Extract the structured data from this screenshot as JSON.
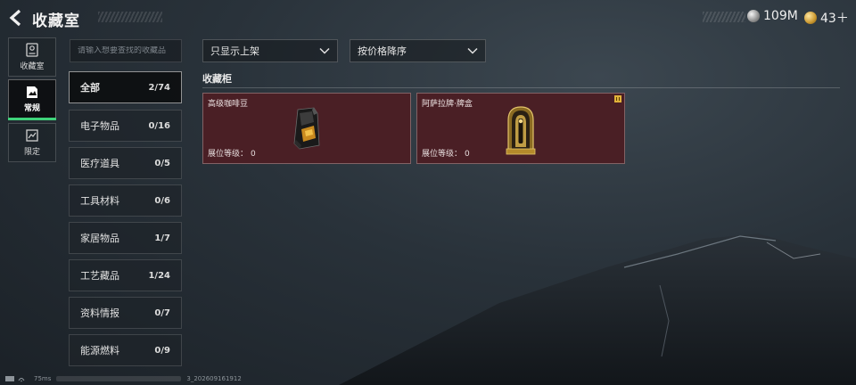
{
  "header": {
    "title": "收藏室",
    "currency": [
      {
        "icon": "silver-coin-icon",
        "value": "109M"
      },
      {
        "icon": "gold-coin-icon",
        "value": "43＋"
      }
    ]
  },
  "nav": [
    {
      "label": "收藏室",
      "icon": "collection-room-icon",
      "active": false
    },
    {
      "label": "常规",
      "icon": "regular-icon",
      "active": true
    },
    {
      "label": "限定",
      "icon": "limited-icon",
      "active": false
    }
  ],
  "search": {
    "placeholder": "请输入想要查找的收藏品"
  },
  "categories": [
    {
      "label": "全部",
      "count": "2/74",
      "active": true
    },
    {
      "label": "电子物品",
      "count": "0/16"
    },
    {
      "label": "医疗道具",
      "count": "0/5"
    },
    {
      "label": "工具材料",
      "count": "0/6"
    },
    {
      "label": "家居物品",
      "count": "1/7"
    },
    {
      "label": "工艺藏品",
      "count": "1/24"
    },
    {
      "label": "资料情报",
      "count": "0/7"
    },
    {
      "label": "能源燃料",
      "count": "0/9"
    }
  ],
  "filters": {
    "shelf": "只显示上架",
    "sort": "按价格降序"
  },
  "section_title": "收藏柜",
  "items": [
    {
      "name": "高级咖啡豆",
      "level_label": "展位等级：",
      "level": "0",
      "icon": "coffee-bean-bag-icon",
      "badge": false
    },
    {
      "name": "阿萨拉牌·牌盒",
      "level_label": "展位等级：",
      "level": "0",
      "icon": "card-box-icon",
      "badge": true
    }
  ],
  "status": {
    "ping": "75ms",
    "build": "3_202609161912"
  },
  "colors": {
    "card_bg": "#4a1f25",
    "active_tab": "#3fd27a",
    "badge": "#e0b23a"
  }
}
